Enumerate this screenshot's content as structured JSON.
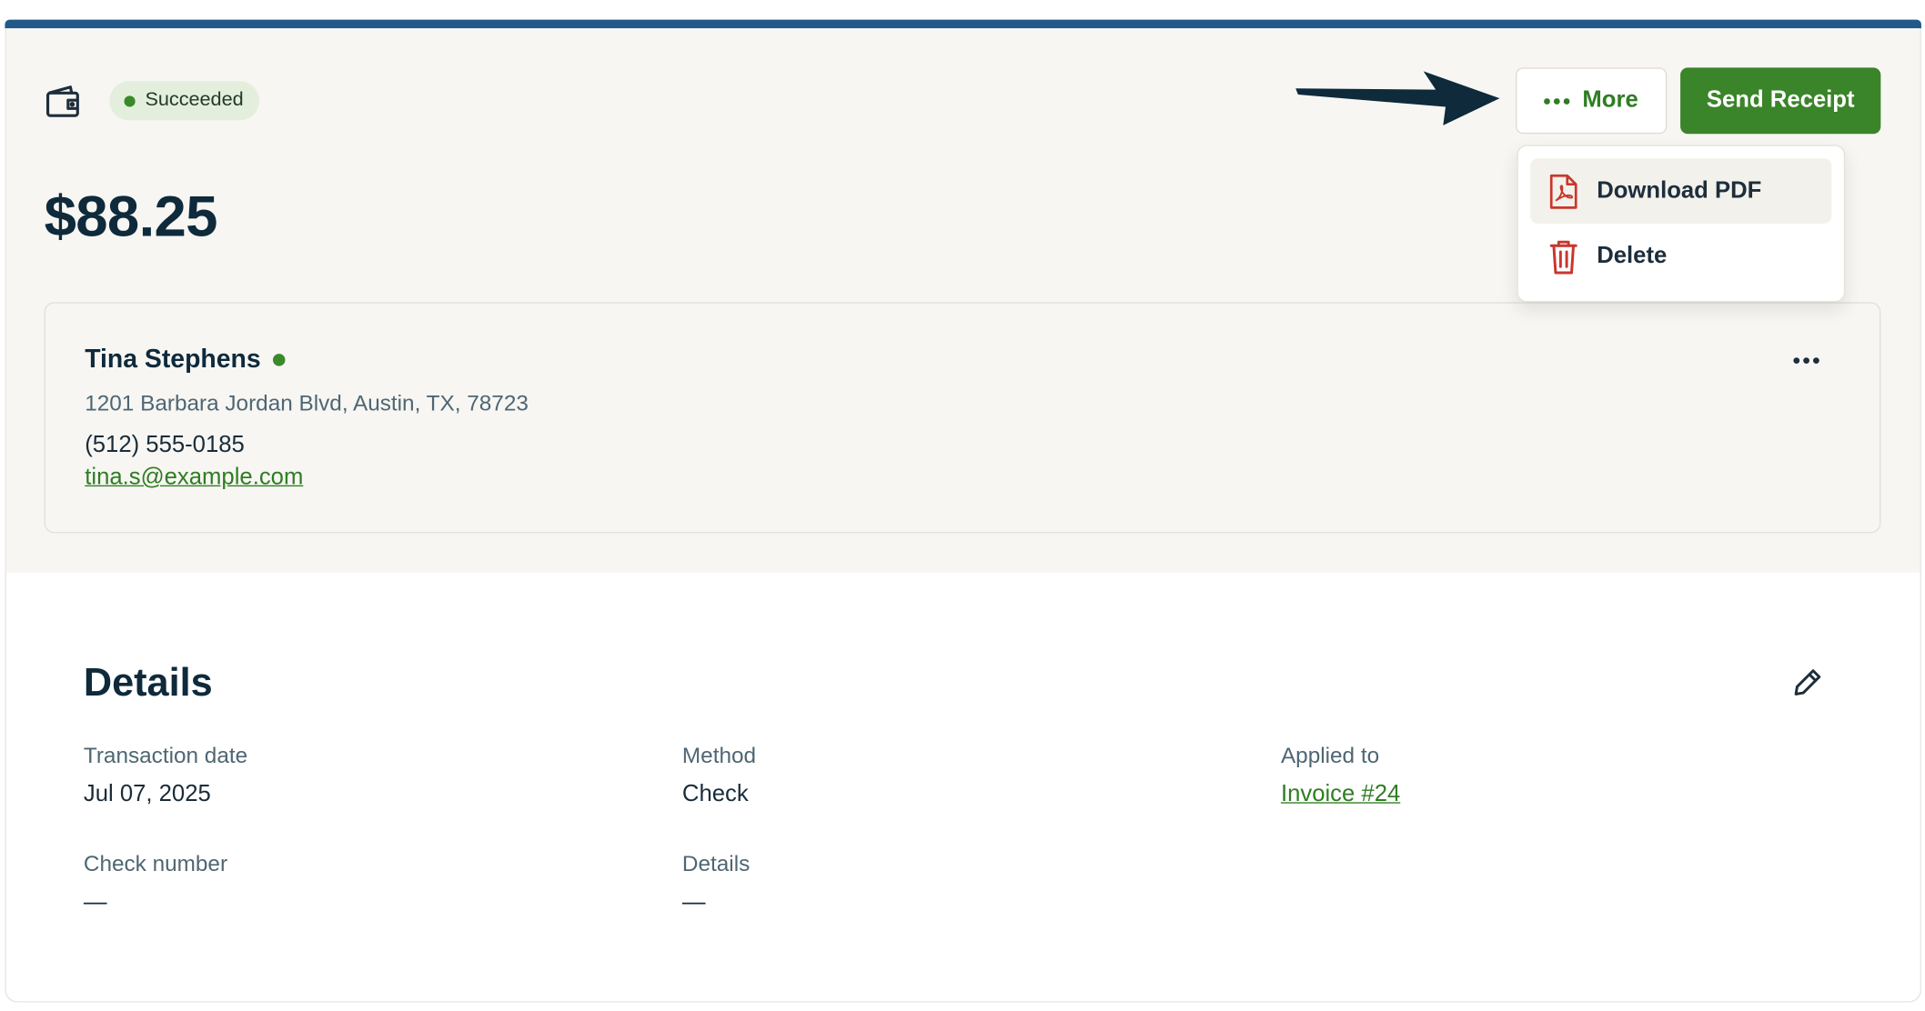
{
  "status": {
    "label": "Succeeded",
    "color": "#3a8a2a"
  },
  "payment": {
    "amount": "$88.25"
  },
  "actions": {
    "more_label": "More",
    "send_receipt_label": "Send Receipt"
  },
  "more_menu": {
    "items": [
      {
        "label": "Download PDF",
        "icon": "pdf-file-icon",
        "highlighted": true
      },
      {
        "label": "Delete",
        "icon": "trash-icon",
        "highlighted": false
      }
    ]
  },
  "customer": {
    "name": "Tina Stephens",
    "address": "1201 Barbara Jordan Blvd, Austin, TX, 78723",
    "phone": "(512) 555-0185",
    "email": "tina.s@example.com"
  },
  "details": {
    "title": "Details",
    "fields": {
      "transaction_date": {
        "label": "Transaction date",
        "value": "Jul 07, 2025"
      },
      "method": {
        "label": "Method",
        "value": "Check"
      },
      "applied_to": {
        "label": "Applied to",
        "value": "Invoice #24"
      },
      "check_number": {
        "label": "Check number",
        "value": "—"
      },
      "extra_details": {
        "label": "Details",
        "value": "—"
      }
    }
  },
  "colors": {
    "accent": "#215a88",
    "primary_button": "#3a8429",
    "link": "#2f7d23",
    "danger_icon": "#c8372d"
  }
}
